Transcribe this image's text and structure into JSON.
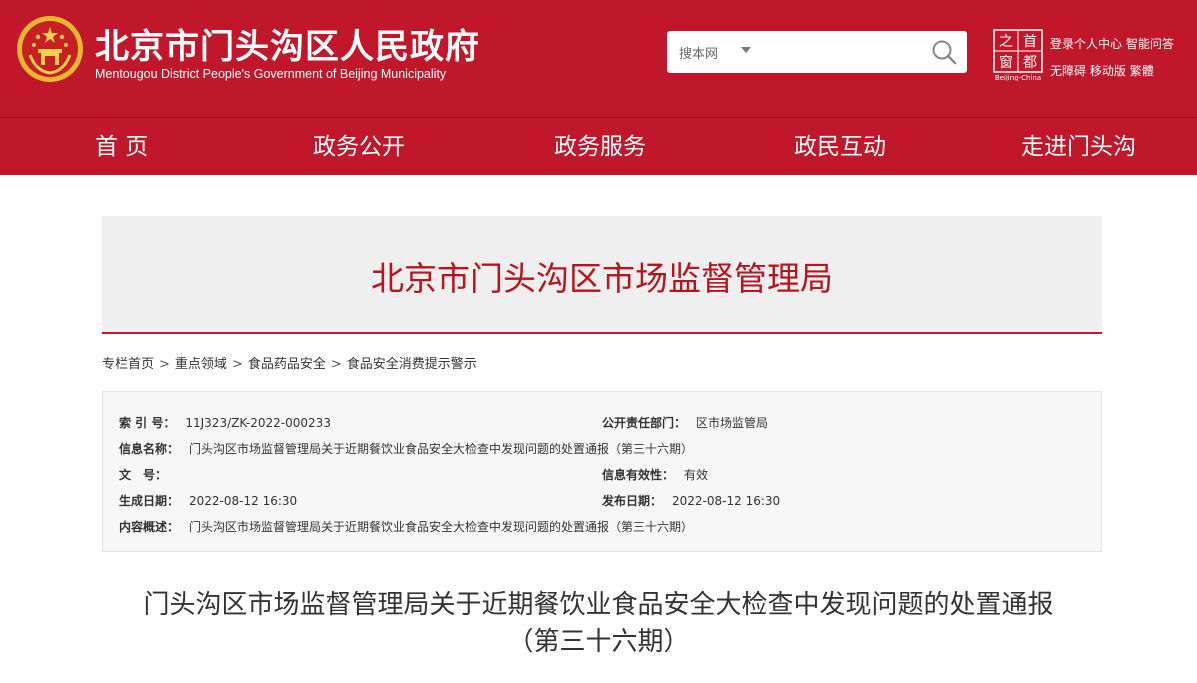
{
  "header": {
    "title": "北京市门头沟区人民政府",
    "subtitle": "Mentougou District People's Government of Beijing Municipality",
    "search": {
      "scope": "搜本网",
      "placeholder": ""
    },
    "capital_logo": {
      "chars": [
        "之",
        "首",
        "窗",
        "都"
      ],
      "caption": "Beijing-China"
    },
    "links_row1": [
      "登录",
      "个人中心",
      "智能问答"
    ],
    "links_row2": [
      "无障碍",
      "移动版",
      "繁體"
    ],
    "brand_color": "#c0172a"
  },
  "nav": {
    "items": [
      "首 页",
      "政务公开",
      "政务服务",
      "政民互动",
      "走进门头沟"
    ]
  },
  "banner": {
    "title": "北京市门头沟区市场监督管理局"
  },
  "breadcrumb": {
    "items": [
      "专栏首页",
      "重点领域",
      "食品药品安全",
      "食品安全消费提示警示"
    ],
    "separator": ">"
  },
  "info": {
    "index_label": "索 引 号：",
    "index_value": "11J323/ZK-2022-000233",
    "dept_label": "公开责任部门：",
    "dept_value": "区市场监管局",
    "name_label": "信息名称：",
    "name_value": "门头沟区市场监督管理局关于近期餐饮业食品安全大检查中发现问题的处置通报（第三十六期）",
    "doc_label": "文　号：",
    "doc_value": "",
    "validity_label": "信息有效性：",
    "validity_value": "有效",
    "created_label": "生成日期：",
    "created_value": "2022-08-12 16:30",
    "published_label": "发布日期：",
    "published_value": "2022-08-12 16:30",
    "summary_label": "内容概述：",
    "summary_value": "门头沟区市场监督管理局关于近期餐饮业食品安全大检查中发现问题的处置通报（第三十六期）"
  },
  "article": {
    "title_line1": "门头沟区市场监督管理局关于近期餐饮业食品安全大检查中发现问题的处置通报",
    "title_line2": "（第三十六期）"
  }
}
